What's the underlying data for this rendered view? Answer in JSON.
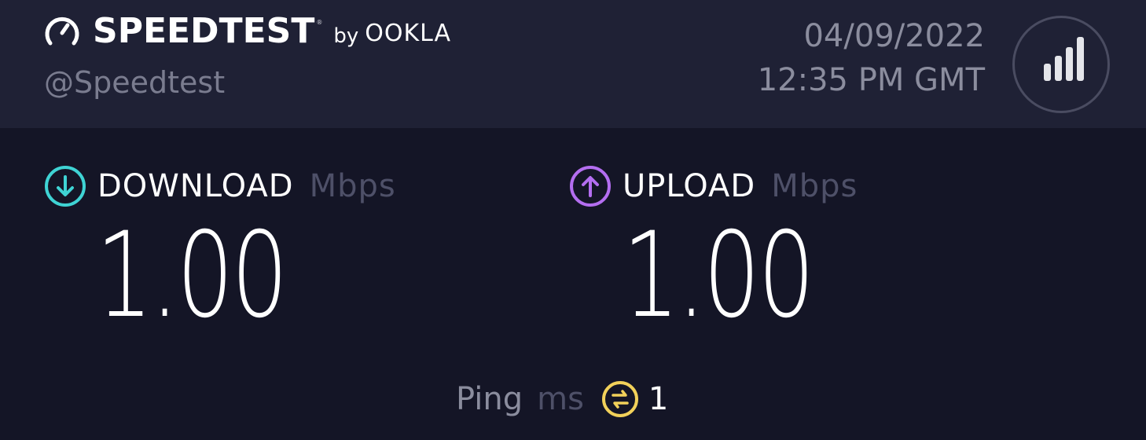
{
  "brand": {
    "name": "SPEEDTEST",
    "trademark": "®",
    "by": "by",
    "company": "OOKLA"
  },
  "handle": "@Speedtest",
  "datetime": {
    "date": "04/09/2022",
    "time": "12:35 PM GMT"
  },
  "download": {
    "label": "DOWNLOAD",
    "unit": "Mbps",
    "value": "1.00",
    "icon": "arrow-down-circle-icon",
    "color": "#3fd3d4"
  },
  "upload": {
    "label": "UPLOAD",
    "unit": "Mbps",
    "value": "1.00",
    "icon": "arrow-up-circle-icon",
    "color": "#b46ef0"
  },
  "ping": {
    "label": "Ping",
    "unit": "ms",
    "value": "1",
    "icon": "ping-circle-icon",
    "color": "#f2d15a"
  },
  "colors": {
    "header_bg": "#1f2135",
    "main_bg": "#141526"
  },
  "signal_button_icon": "signal-bars-icon"
}
